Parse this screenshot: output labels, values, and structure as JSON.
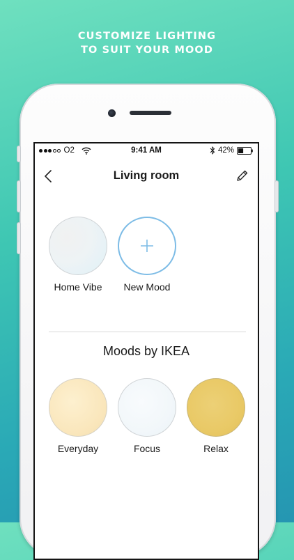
{
  "promo": {
    "headline_line1": "CUSTOMIZE LIGHTING",
    "headline_line2": "TO SUIT YOUR MOOD"
  },
  "status_bar": {
    "carrier": "O2",
    "signal_bars_filled": 3,
    "signal_bars_total": 5,
    "time": "9:41 AM",
    "battery_percent": "42%",
    "battery_level": 0.42
  },
  "nav": {
    "title": "Living room",
    "back_icon": "chevron-left-icon",
    "edit_icon": "pencil-icon"
  },
  "my_moods": [
    {
      "label": "Home Vibe",
      "color": "#eef3f5"
    },
    {
      "label": "New Mood",
      "icon": "plus-icon",
      "accent": "#7dbce6"
    }
  ],
  "ikea_section": {
    "title": "Moods by IKEA",
    "moods": [
      {
        "label": "Everyday",
        "color": "#fae7bd"
      },
      {
        "label": "Focus",
        "color": "#f2f7fa"
      },
      {
        "label": "Relax",
        "color": "#e9c966"
      }
    ]
  },
  "colors": {
    "background_top": "#6fe0bf",
    "background_bottom": "#2596b2",
    "accent_blue": "#7dbce6"
  }
}
